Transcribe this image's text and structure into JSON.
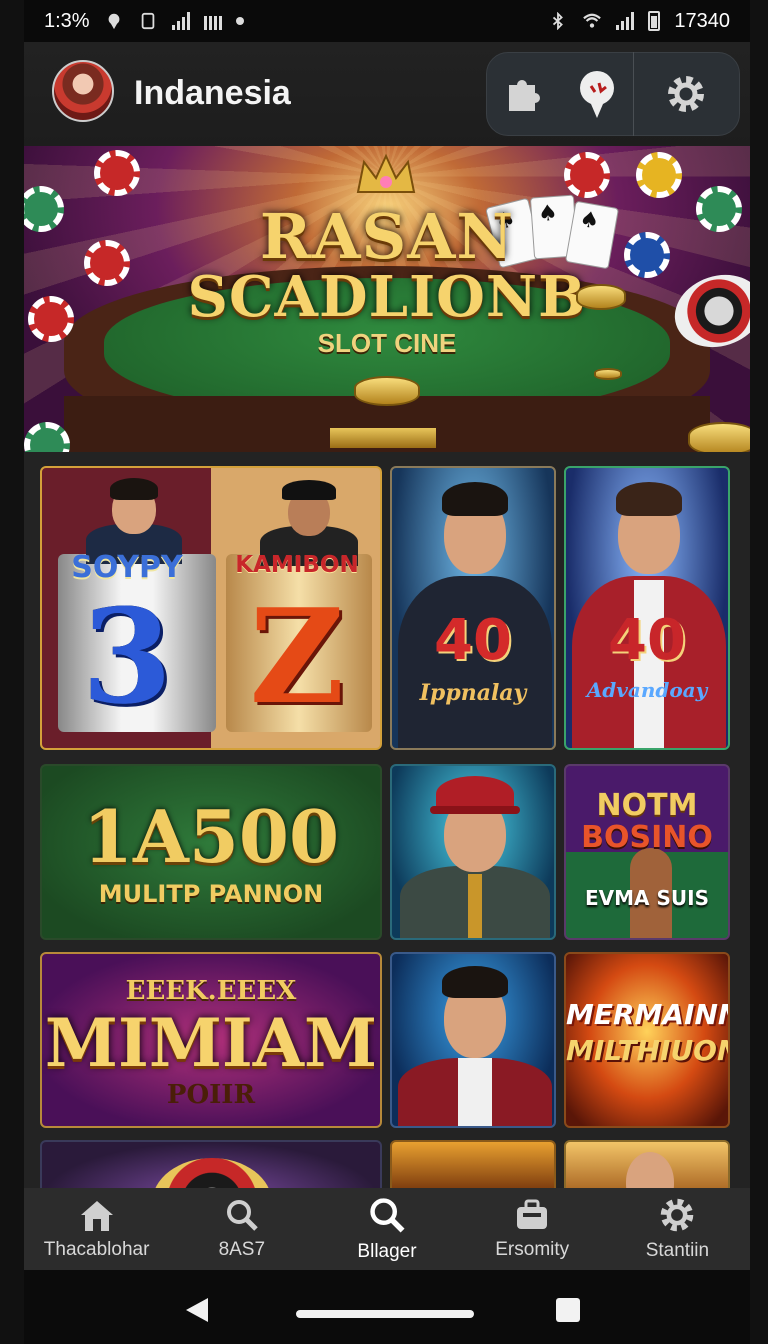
{
  "status_bar": {
    "left_text": "1:3%",
    "time": "17340"
  },
  "header": {
    "title": "Indanesia",
    "actions": [
      "puzzle-icon",
      "pin-icon",
      "gear-icon"
    ]
  },
  "hero": {
    "title_line1": "RASAN",
    "title_line2": "SCADLIONB",
    "subtitle": "SLOT CINE"
  },
  "games": [
    {
      "label": "SOYPY",
      "number": "3"
    },
    {
      "label": "KAMIBON",
      "number": "Z"
    },
    {
      "number": "40",
      "script": "Ippnalay"
    },
    {
      "number": "40",
      "script": "Advandoay"
    },
    {
      "title": "1A500",
      "subtitle": "MULITP PANNON"
    },
    {
      "image": "man-with-cap-on-phone"
    },
    {
      "line1": "NOTM",
      "line2": "BOSINO",
      "line3": "EVMA SUIS"
    },
    {
      "top": "EEEK.EEEX",
      "title": "MIMIAM",
      "bottom": "POIIR"
    },
    {
      "image": "man-red-jacket-on-phone"
    },
    {
      "line1": "MERMAINN",
      "line2": "MILTHIUON"
    }
  ],
  "bottom_nav": {
    "items": [
      {
        "icon": "home-icon",
        "label": "Thacablohar"
      },
      {
        "icon": "search-icon",
        "label": "8AS7"
      },
      {
        "icon": "search-icon",
        "label": "Bllager"
      },
      {
        "icon": "briefcase-icon",
        "label": "Ersomity"
      },
      {
        "icon": "gear-icon",
        "label": "Stantiin"
      }
    ],
    "active_index": 2,
    "active_color": "#c62828"
  },
  "colors": {
    "gold": "#f6d36d",
    "felt": "#2f8a3e"
  }
}
